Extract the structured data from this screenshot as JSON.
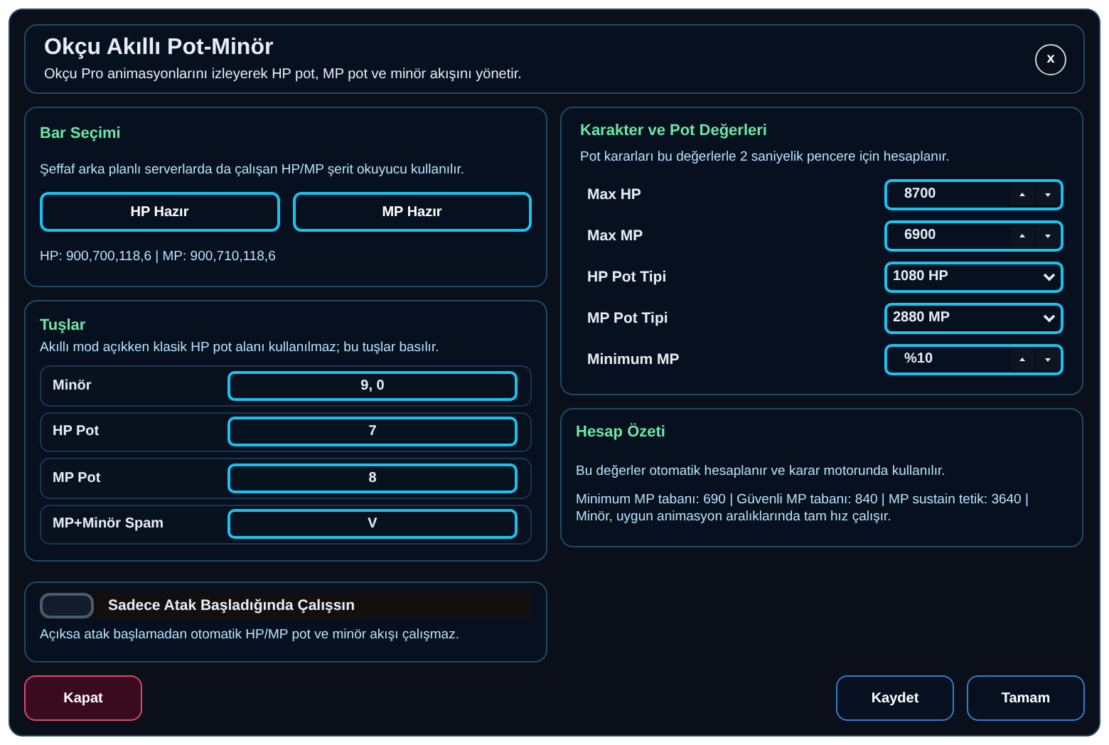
{
  "window": {
    "title": "Okçu Akıllı Pot-Minör",
    "subtitle": "Okçu Pro animasyonlarını izleyerek HP pot, MP pot ve minör akışını yönetir.",
    "close": "x"
  },
  "bar_selection": {
    "title": "Bar Seçimi",
    "description": "Şeffaf arka planlı serverlarda da çalışan HP/MP şerit okuyucu kullanılır.",
    "buttons": [
      "HP Hazır",
      "MP Hazır"
    ],
    "readout": "HP: 900,700,118,6 | MP: 900,710,118,6"
  },
  "keys": {
    "title": "Tuşlar",
    "description": "Akıllı mod açıkken klasik HP pot alanı kullanılmaz; bu tuşlar basılır.",
    "rows": [
      {
        "label": "Minör",
        "value": "9, 0"
      },
      {
        "label": "HP Pot",
        "value": "7"
      },
      {
        "label": "MP Pot",
        "value": "8"
      },
      {
        "label": "MP+Minör Spam",
        "value": "V"
      }
    ]
  },
  "attack_only": {
    "label": "Sadece Atak Başladığında Çalışsın",
    "on": false,
    "description": "Açıksa atak başlamadan otomatik HP/MP pot ve minör akışı çalışmaz."
  },
  "character": {
    "title": "Karakter ve Pot Değerleri",
    "description": "Pot kararları bu değerlerle 2 saniyelik pencere için hesaplanır.",
    "fields": [
      {
        "label": "Max HP",
        "kind": "spinner",
        "value": "8700"
      },
      {
        "label": "Max MP",
        "kind": "spinner",
        "value": "6900"
      },
      {
        "label": "HP Pot Tipi",
        "kind": "select",
        "value": "1080 HP"
      },
      {
        "label": "MP Pot Tipi",
        "kind": "select",
        "value": "2880 MP"
      },
      {
        "label": "Minimum MP",
        "kind": "spinner",
        "value": "%10"
      }
    ]
  },
  "summary": {
    "title": "Hesap Özeti",
    "description": "Bu değerler otomatik hesaplanır ve karar motorunda kullanılır.",
    "details": "Minimum MP tabanı: 690 | Güvenli MP tabanı: 840 | MP sustain tetik: 3640 | Minör, uygun animasyon aralıklarında tam hız çalışır."
  },
  "footer": {
    "close": "Kapat",
    "buttons": [
      "Kaydet",
      "Tamam"
    ]
  }
}
